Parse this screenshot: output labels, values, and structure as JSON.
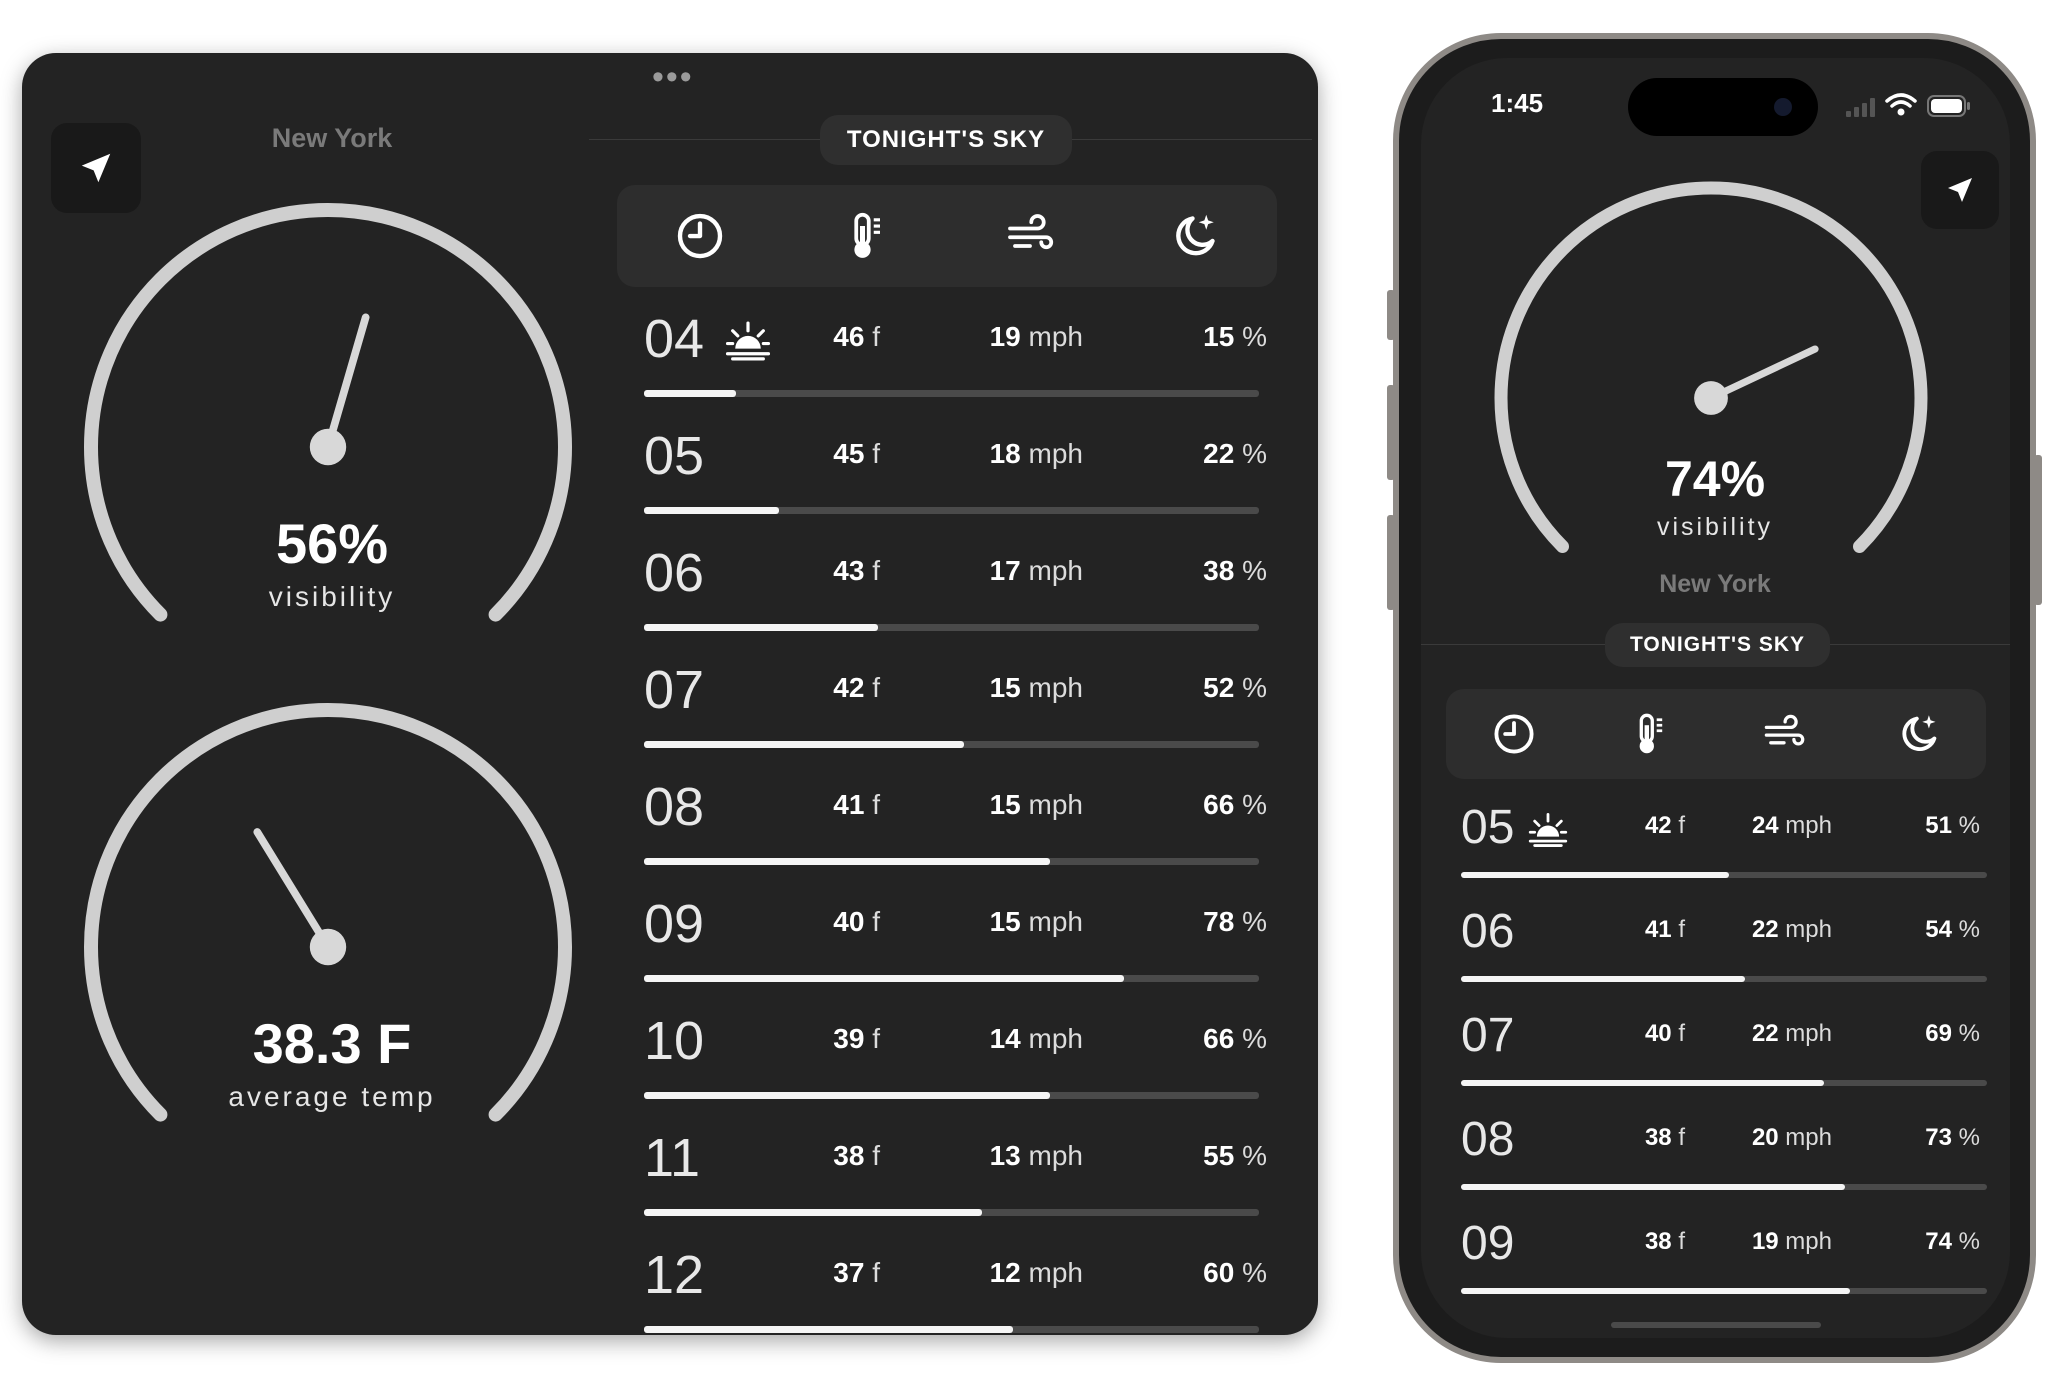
{
  "tablet": {
    "menu_dots": "•••",
    "city": "New York",
    "visibility_gauge": {
      "value": "56%",
      "label": "visibility",
      "level": 0.56
    },
    "temp_gauge": {
      "value": "38.3 F",
      "label": "average temp",
      "level": 0.383
    },
    "section_title": "TONIGHT'S SKY",
    "tabs": [
      {
        "name": "clock-icon"
      },
      {
        "name": "thermometer-icon"
      },
      {
        "name": "wind-icon"
      },
      {
        "name": "moon-stars-icon"
      }
    ],
    "units": {
      "temp": "f",
      "wind": "mph",
      "pct": "%"
    },
    "rows": [
      {
        "hour": "04",
        "sunrise": true,
        "temp": "46",
        "wind": "19",
        "pct": "15",
        "level": 0.15
      },
      {
        "hour": "05",
        "sunrise": false,
        "temp": "45",
        "wind": "18",
        "pct": "22",
        "level": 0.22
      },
      {
        "hour": "06",
        "sunrise": false,
        "temp": "43",
        "wind": "17",
        "pct": "38",
        "level": 0.38
      },
      {
        "hour": "07",
        "sunrise": false,
        "temp": "42",
        "wind": "15",
        "pct": "52",
        "level": 0.52
      },
      {
        "hour": "08",
        "sunrise": false,
        "temp": "41",
        "wind": "15",
        "pct": "66",
        "level": 0.66
      },
      {
        "hour": "09",
        "sunrise": false,
        "temp": "40",
        "wind": "15",
        "pct": "78",
        "level": 0.78
      },
      {
        "hour": "10",
        "sunrise": false,
        "temp": "39",
        "wind": "14",
        "pct": "66",
        "level": 0.66
      },
      {
        "hour": "11",
        "sunrise": false,
        "temp": "38",
        "wind": "13",
        "pct": "55",
        "level": 0.55
      },
      {
        "hour": "12",
        "sunrise": false,
        "temp": "37",
        "wind": "12",
        "pct": "60",
        "level": 0.6
      }
    ]
  },
  "phone": {
    "status": {
      "time": "1:45"
    },
    "visibility_gauge": {
      "value": "74%",
      "label": "visibility",
      "level": 0.74
    },
    "city": "New York",
    "section_title": "TONIGHT'S SKY",
    "rows": [
      {
        "hour": "05",
        "sunrise": true,
        "temp": "42",
        "wind": "24",
        "pct": "51",
        "level": 0.51
      },
      {
        "hour": "06",
        "sunrise": false,
        "temp": "41",
        "wind": "22",
        "pct": "54",
        "level": 0.54
      },
      {
        "hour": "07",
        "sunrise": false,
        "temp": "40",
        "wind": "22",
        "pct": "69",
        "level": 0.69
      },
      {
        "hour": "08",
        "sunrise": false,
        "temp": "38",
        "wind": "20",
        "pct": "73",
        "level": 0.73
      },
      {
        "hour": "09",
        "sunrise": false,
        "temp": "38",
        "wind": "19",
        "pct": "74",
        "level": 0.74
      }
    ]
  }
}
